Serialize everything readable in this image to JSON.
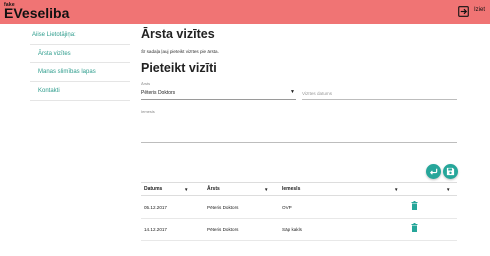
{
  "app": {
    "brand_small": "fake",
    "brand_large": "EVeseliba",
    "logout_label": "Iziet"
  },
  "sidebar": {
    "title": "Aiise Lietotājiņa:",
    "items": [
      {
        "label": "Ārsta vizītes"
      },
      {
        "label": "Manas slimības lapas"
      },
      {
        "label": "Kontakti"
      }
    ]
  },
  "main": {
    "page_title": "Ārsta vizītes",
    "subtitle": "Šī sadaļa ļauj pieteikt vizītes pie ārsta.",
    "form_title": "Pieteikt vizīti",
    "doctor_label": "Ārsts",
    "doctor_value": "Pēteris Doktors",
    "date_placeholder": "Vizītes datums",
    "reason_label": "Iemesls"
  },
  "table": {
    "headers": [
      "Datums",
      "Ārsts",
      "Iemesls",
      ""
    ],
    "rows": [
      {
        "date": "05.12.2017",
        "doctor": "Pēteris Doktors",
        "reason": "OVP"
      },
      {
        "date": "14.12.2017",
        "doctor": "Pēteris Doktors",
        "reason": "Sāp kakls"
      }
    ]
  },
  "colors": {
    "header": "#f07474",
    "accent": "#26a69a",
    "link": "#2c9c8c"
  },
  "icons": {
    "logout": "logout-icon",
    "back": "back-icon",
    "save": "save-icon",
    "delete": "trash-icon"
  }
}
